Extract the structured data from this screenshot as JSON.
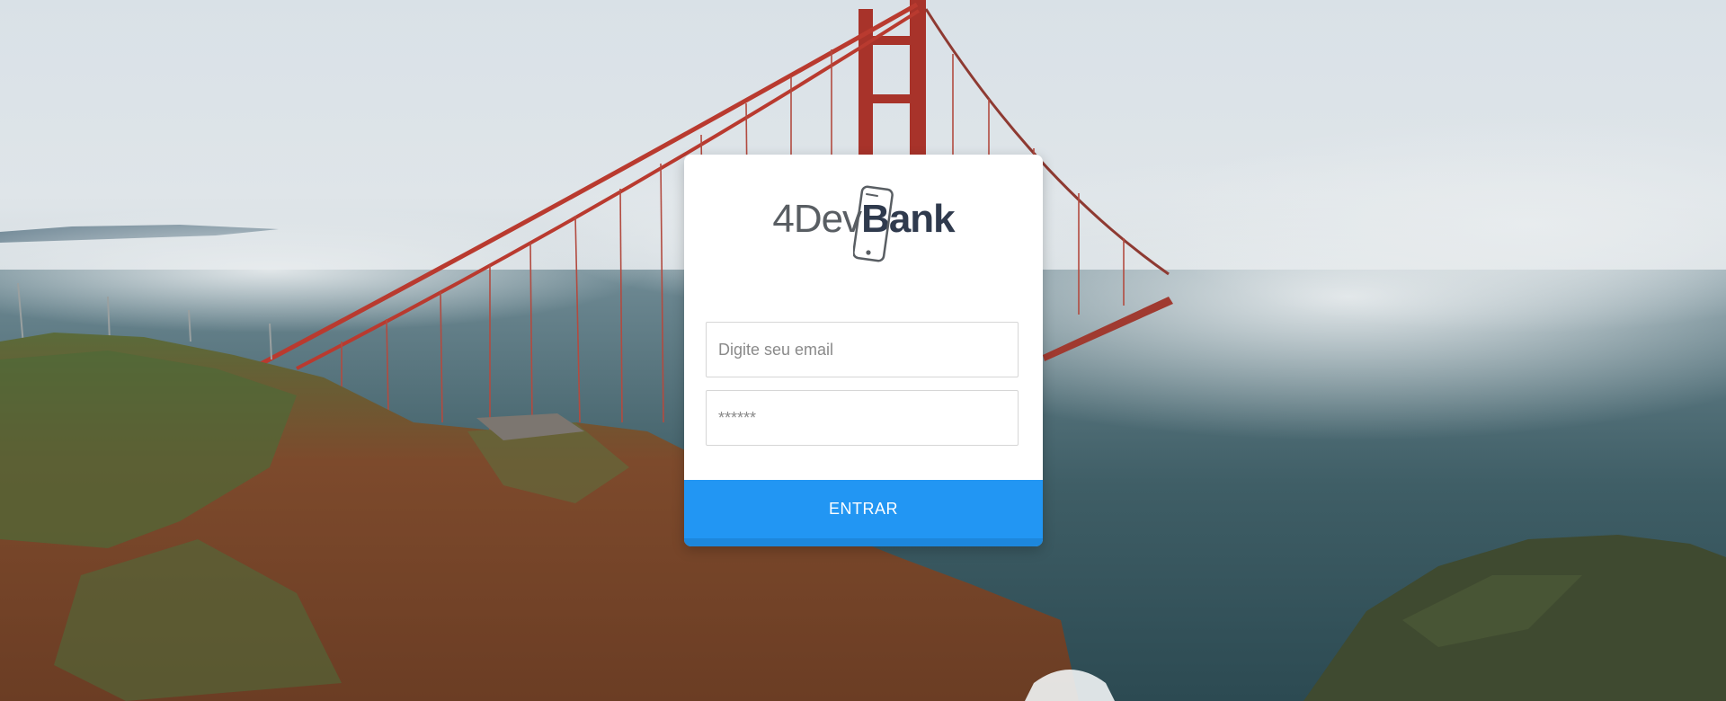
{
  "brand": {
    "logo_light": "4Dev",
    "logo_bold": "Bank",
    "icon": "smartphone-icon"
  },
  "login": {
    "email_placeholder": "Digite seu email",
    "email_value": "",
    "password_placeholder": "******",
    "password_value": "",
    "submit_label": "ENTRAR"
  },
  "colors": {
    "primary": "#2296f3",
    "logo_dark": "#2f3a4d",
    "logo_gray": "#595e63"
  }
}
